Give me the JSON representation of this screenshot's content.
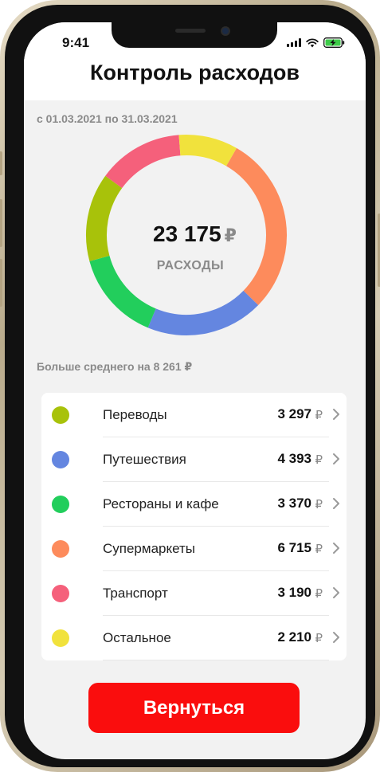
{
  "status_bar": {
    "time": "9:41"
  },
  "header": {
    "title": "Контроль расходов"
  },
  "period": {
    "text": "с 01.03.2021 по 31.03.2021"
  },
  "summary": {
    "total_value": "23 175",
    "currency": "₽",
    "label": "РАСХОДЫ",
    "comparison": "Больше среднего на 8 261 ₽"
  },
  "categories": [
    {
      "name": "Переводы",
      "amount": "3 297",
      "currency": "₽",
      "value": 3297,
      "color": "#a8c20a"
    },
    {
      "name": "Путешествия",
      "amount": "4 393",
      "currency": "₽",
      "value": 4393,
      "color": "#6486e0"
    },
    {
      "name": "Рестораны и кафе",
      "amount": "3 370",
      "currency": "₽",
      "value": 3370,
      "color": "#22ce5c"
    },
    {
      "name": "Супермаркеты",
      "amount": "6 715",
      "currency": "₽",
      "value": 6715,
      "color": "#fd8b5c"
    },
    {
      "name": "Транспорт",
      "amount": "3 190",
      "currency": "₽",
      "value": 3190,
      "color": "#f5607b"
    },
    {
      "name": "Остальное",
      "amount": "2 210",
      "currency": "₽",
      "value": 2210,
      "color": "#f1e23c"
    }
  ],
  "chart_order": [
    3,
    1,
    2,
    0,
    4,
    5
  ],
  "back_button": {
    "label": "Вернуться"
  },
  "colors": {
    "accent": "#fa0d0d",
    "background": "#f2f2f2"
  }
}
